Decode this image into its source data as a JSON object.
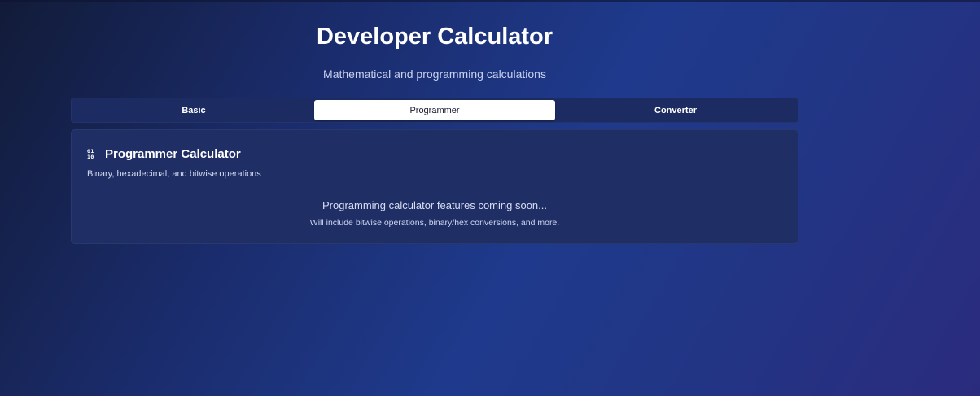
{
  "header": {
    "title": "Developer Calculator",
    "subtitle": "Mathematical and programming calculations"
  },
  "tabs": [
    {
      "label": "Basic",
      "active": false
    },
    {
      "label": "Programmer",
      "active": true
    },
    {
      "label": "Converter",
      "active": false
    }
  ],
  "card": {
    "icon": "binary-icon",
    "icon_lines": [
      "01",
      "10"
    ],
    "title": "Programmer Calculator",
    "description": "Binary, hexadecimal, and bitwise operations",
    "message": "Programming calculator features coming soon...",
    "message_sub": "Will include bitwise operations, binary/hex conversions, and more."
  },
  "colors": {
    "background_start": "#121b38",
    "background_mid": "#1f3a8c",
    "background_end": "#2b2b7e",
    "tab_bar": "#1c2c62",
    "card": "#1f2f66",
    "active_tab": "#ffffff"
  }
}
